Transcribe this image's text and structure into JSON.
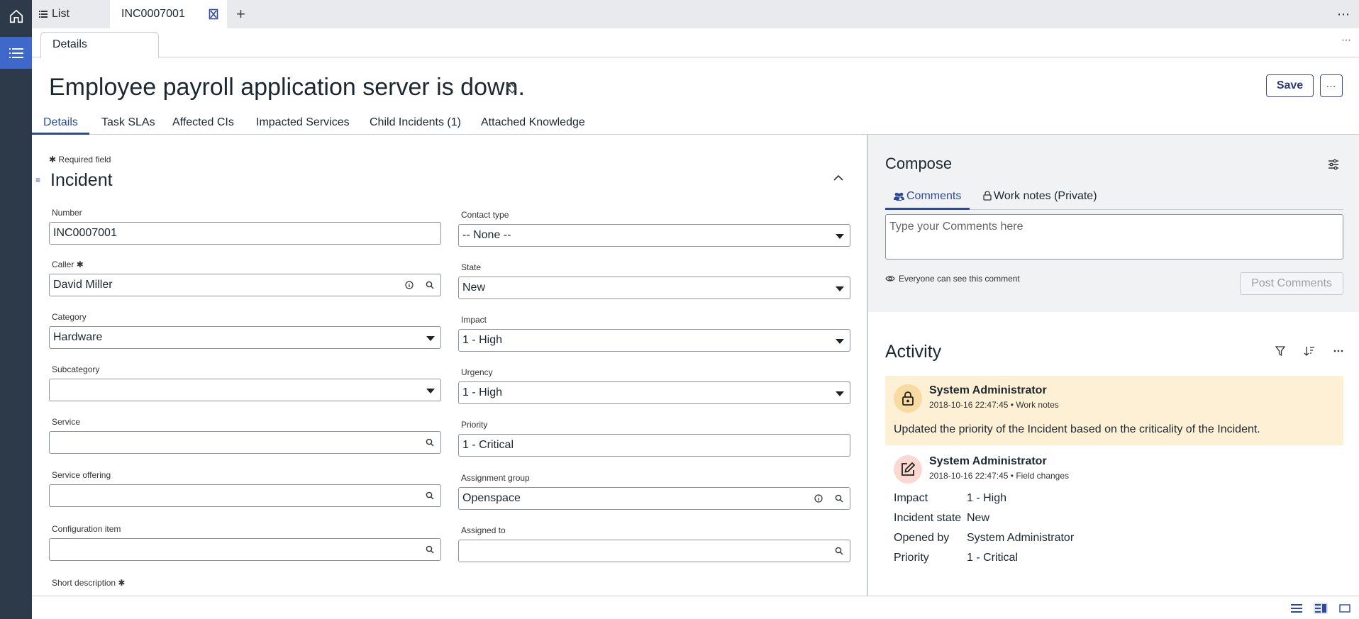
{
  "top_tabs": {
    "list_label": "List",
    "record_label": "INC0007001"
  },
  "sub_tab": {
    "label": "Details"
  },
  "header": {
    "title": "Employee payroll application server is down.",
    "save_label": "Save"
  },
  "record_tabs": [
    "Details",
    "Task SLAs",
    "Affected CIs",
    "Impacted Services",
    "Child Incidents (1)",
    "Attached Knowledge"
  ],
  "form": {
    "required_note": "Required field",
    "section_title": "Incident",
    "required_mark": "✱",
    "fields": {
      "number": {
        "label": "Number",
        "value": "INC0007001"
      },
      "caller": {
        "label": "Caller",
        "value": "David Miller"
      },
      "category": {
        "label": "Category",
        "value": "Hardware"
      },
      "subcategory": {
        "label": "Subcategory",
        "value": ""
      },
      "service": {
        "label": "Service",
        "value": ""
      },
      "service_offering": {
        "label": "Service offering",
        "value": ""
      },
      "configuration_item": {
        "label": "Configuration item",
        "value": ""
      },
      "short_description": {
        "label": "Short description"
      },
      "contact_type": {
        "label": "Contact type",
        "value": "-- None --"
      },
      "state": {
        "label": "State",
        "value": "New"
      },
      "impact": {
        "label": "Impact",
        "value": "1 - High"
      },
      "urgency": {
        "label": "Urgency",
        "value": "1 - High"
      },
      "priority": {
        "label": "Priority",
        "value": "1 - Critical"
      },
      "assignment_group": {
        "label": "Assignment group",
        "value": "Openspace"
      },
      "assigned_to": {
        "label": "Assigned to",
        "value": ""
      }
    }
  },
  "compose": {
    "title": "Compose",
    "tabs": [
      "Comments",
      "Work notes (Private)"
    ],
    "placeholder": "Type your Comments here",
    "visibility_note": "Everyone can see this comment",
    "post_label": "Post Comments"
  },
  "activity": {
    "title": "Activity",
    "entries": [
      {
        "author": "System Administrator",
        "timestamp": "2018-10-16 22:47:45",
        "type": "Work notes",
        "message": "Updated the priority of the Incident based on the criticality of the Incident."
      },
      {
        "author": "System Administrator",
        "timestamp": "2018-10-16 22:47:45",
        "type": "Field changes",
        "changes": [
          {
            "field": "Impact",
            "value": "1 - High"
          },
          {
            "field": "Incident state",
            "value": "New"
          },
          {
            "field": "Opened by",
            "value": "System Administrator"
          },
          {
            "field": "Priority",
            "value": "1 - Critical"
          }
        ]
      }
    ]
  },
  "colors": {
    "rail": "#2d3a4a",
    "rail_active": "#3e68c9",
    "accent": "#2c4a9c",
    "work_note_bg": "#fdf0d5"
  }
}
